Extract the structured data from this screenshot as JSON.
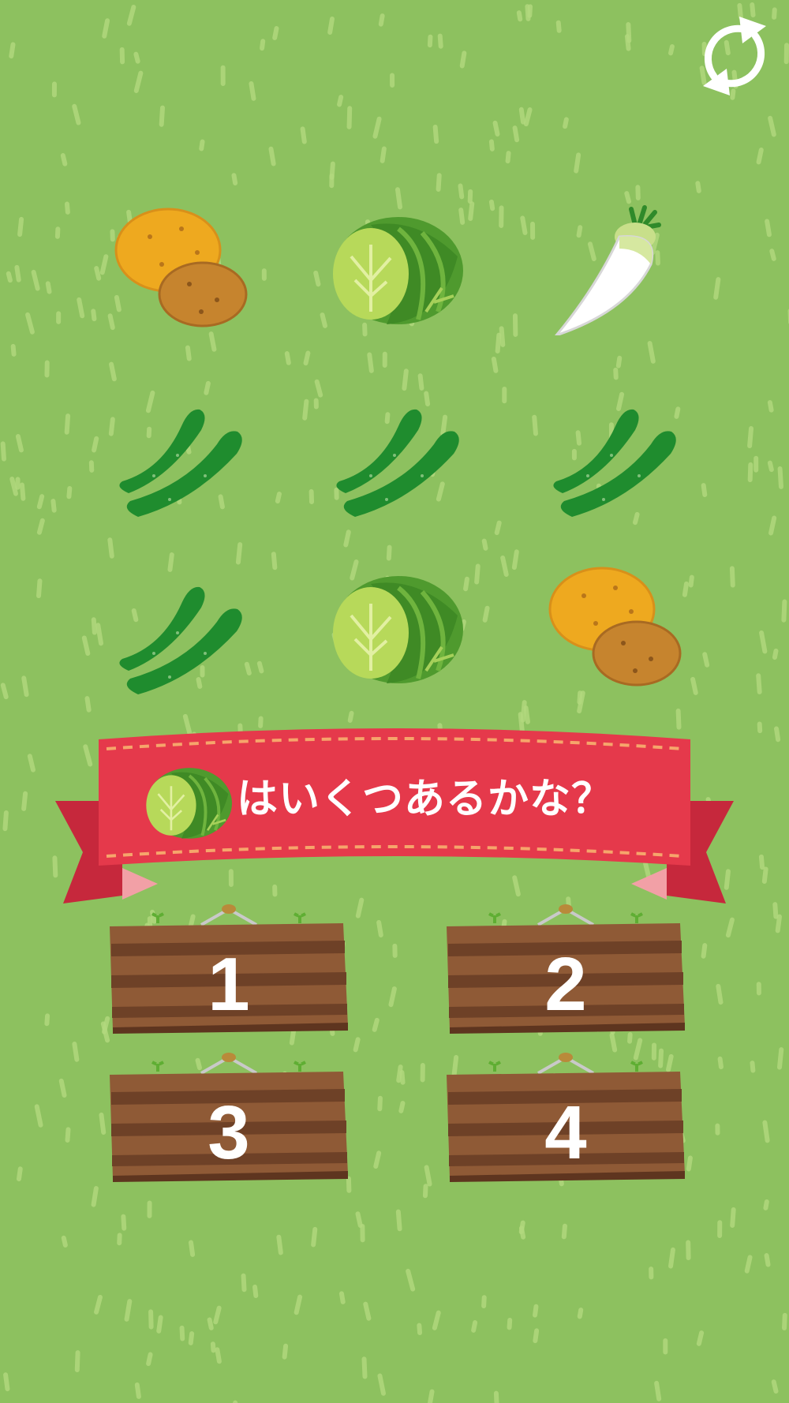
{
  "colors": {
    "grass": "#8dc15f",
    "grass_stroke": "#b3d87e",
    "ribbon": "#e5394b",
    "ribbon_dark": "#c6283c",
    "stitch": "#f6a56b",
    "board": "#8f5a36",
    "board_stripe": "#6e4127"
  },
  "header": {
    "refresh_icon": "refresh-icon"
  },
  "board": {
    "items": [
      {
        "name": "potato",
        "icon": "potato-icon"
      },
      {
        "name": "cabbage",
        "icon": "cabbage-icon"
      },
      {
        "name": "daikon",
        "icon": "daikon-icon"
      },
      {
        "name": "cucumber",
        "icon": "cucumber-icon"
      },
      {
        "name": "cucumber",
        "icon": "cucumber-icon"
      },
      {
        "name": "cucumber",
        "icon": "cucumber-icon"
      },
      {
        "name": "cucumber",
        "icon": "cucumber-icon"
      },
      {
        "name": "cabbage",
        "icon": "cabbage-icon"
      },
      {
        "name": "potato",
        "icon": "potato-icon"
      }
    ]
  },
  "question": {
    "target_icon": "cabbage-icon",
    "text": "はいくつあるかな？"
  },
  "answers": [
    {
      "label": "1"
    },
    {
      "label": "2"
    },
    {
      "label": "3"
    },
    {
      "label": "4"
    }
  ]
}
